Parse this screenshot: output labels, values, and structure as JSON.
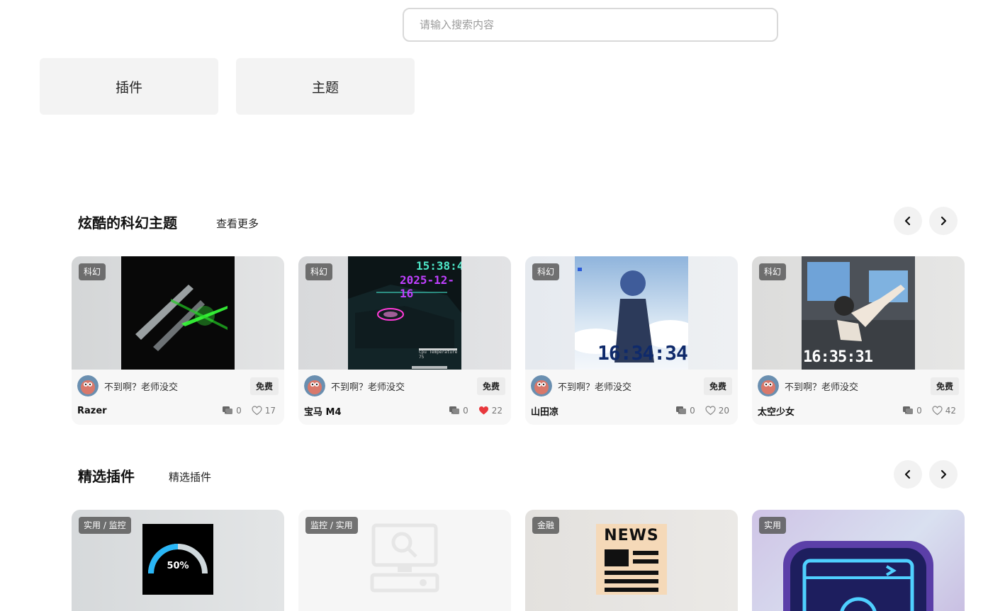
{
  "search": {
    "placeholder": "请输入搜索内容"
  },
  "categories": [
    {
      "label": "插件"
    },
    {
      "label": "主题"
    }
  ],
  "sections": [
    {
      "title": "炫酷的科幻主题",
      "more": "查看更多",
      "cards": [
        {
          "tag": "科幻",
          "author": "不到啊？老师没交",
          "price": "免费",
          "name": "Razer",
          "comments": "0",
          "likes": "17",
          "liked": false,
          "thumb": "razer"
        },
        {
          "tag": "科幻",
          "author": "不到啊？老师没交",
          "price": "免费",
          "name": "宝马 M4",
          "comments": "0",
          "likes": "22",
          "liked": true,
          "thumb": "bmw",
          "clock_time": "15:38:44",
          "clock_date": "2025-12-16",
          "overlay_1": "Cpu Temperature  75"
        },
        {
          "tag": "科幻",
          "author": "不到啊？老师没交",
          "price": "免费",
          "name": "山田凉",
          "comments": "0",
          "likes": "20",
          "liked": false,
          "thumb": "anime",
          "clock_time": "16:34:34"
        },
        {
          "tag": "科幻",
          "author": "不到啊？老师没交",
          "price": "免费",
          "name": "太空少女",
          "comments": "0",
          "likes": "42",
          "liked": false,
          "thumb": "space",
          "clock_time": "16:35:31"
        }
      ]
    },
    {
      "title": "精选插件",
      "more": "精选插件",
      "cards": [
        {
          "tag": "实用 / 监控",
          "thumb": "gauge",
          "gauge_value": "50%"
        },
        {
          "tag": "监控 / 实用",
          "thumb": "monitor"
        },
        {
          "tag": "金融",
          "thumb": "news",
          "news_label": "NEWS"
        },
        {
          "tag": "实用",
          "thumb": "neon"
        }
      ]
    }
  ],
  "colors": {
    "liked_heart": "#e8383d",
    "tag_bg": "#5a5a5a",
    "card_bg": "#f7f7f7"
  }
}
